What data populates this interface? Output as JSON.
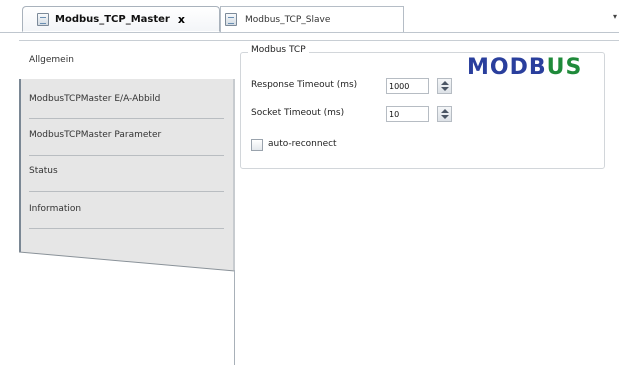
{
  "tabs": [
    {
      "label": "Modbus_TCP_Master",
      "active": true,
      "close_label": "x"
    },
    {
      "label": "Modbus_TCP_Slave",
      "active": false
    }
  ],
  "tab_dropdown": "▾",
  "nav": {
    "items": [
      {
        "label": "Allgemein",
        "active": true
      },
      {
        "label": "ModbusTCPMaster E/A-Abbild"
      },
      {
        "label": "ModbusTCPMaster Parameter"
      },
      {
        "label": "Status"
      },
      {
        "label": "Information"
      }
    ]
  },
  "group": {
    "title": "Modbus TCP",
    "response_timeout_label": "Response  Timeout (ms)",
    "response_timeout_value": "1000",
    "socket_timeout_label": "Socket Timeout (ms)",
    "socket_timeout_value": "10",
    "auto_reconnect_label": "auto-reconnect",
    "auto_reconnect_checked": false
  },
  "logo": {
    "part1": "MODB",
    "part2": "US",
    "color_blue": "#2a3f9d",
    "color_green": "#1f8a3a"
  }
}
